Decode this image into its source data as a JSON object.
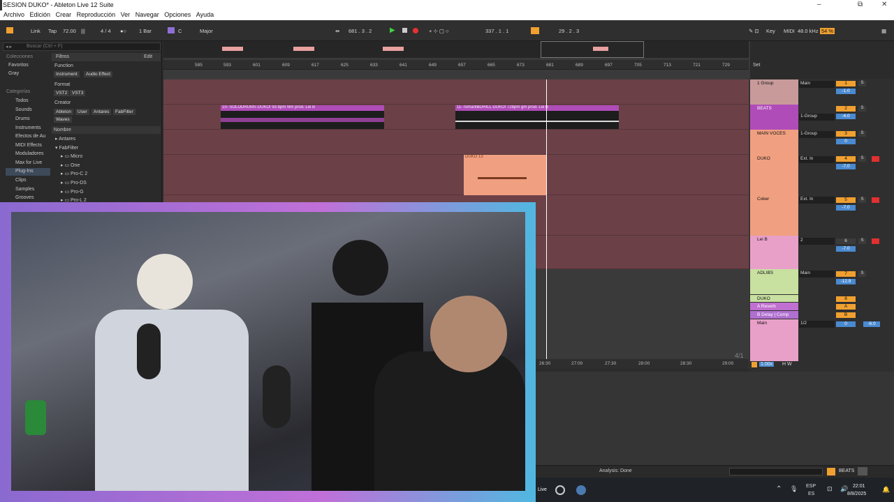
{
  "window": {
    "title": "SESION DUKO* - Ableton Live 12 Suite",
    "controls": [
      "–",
      "⧉",
      "✕"
    ]
  },
  "menu": [
    "Archivo",
    "Edición",
    "Crear",
    "Reproducción",
    "Ver",
    "Navegar",
    "Opciones",
    "Ayuda"
  ],
  "transport": {
    "link": "Link",
    "tap": "Tap",
    "tempo": "72.00",
    "sig": "4 / 4",
    "quant": "1 Bar",
    "key": "C",
    "scale": "Major",
    "pos": "681 .  3 .  2",
    "loop": "337 .  1 .  1",
    "len": "29 .  2 .  3",
    "key_btn": "Key",
    "midi": "MIDI",
    "sr": "48.0 kHz",
    "cpu": "54 %"
  },
  "browser": {
    "search": "Buscar (Ctrl + F)",
    "filtros": "Filtros",
    "edit": "Edit",
    "col_header": "Colecciones",
    "collections": [
      "Favoritos",
      "Gray"
    ],
    "cat_header": "Categorías",
    "categories": [
      "Todos",
      "Sounds",
      "Drums",
      "Instruments",
      "Efectos de Au",
      "MIDI Effects",
      "Moduladores",
      "Max for Live",
      "Plug-Ins",
      "Clips",
      "Samples",
      "Grooves"
    ],
    "function": "Function",
    "function_tags": [
      "Instrument",
      "Audio Effect"
    ],
    "format": "Format",
    "format_tags": [
      "VST2",
      "VST3"
    ],
    "creator": "Creator",
    "creator_tags": [
      "Ableton",
      "User",
      "Antares",
      "FabFilter",
      "Waves"
    ],
    "nombre": "Nombre",
    "tree": [
      "Antares",
      "FabFilter",
      "Micro",
      "One",
      "Pro-C 2",
      "Pro-DS",
      "Pro-G",
      "Pro-L 2"
    ]
  },
  "ruler": [
    "585",
    "593",
    "601",
    "609",
    "617",
    "625",
    "633",
    "641",
    "649",
    "657",
    "665",
    "673",
    "681",
    "689",
    "697",
    "705",
    "713",
    "721",
    "729"
  ],
  "clips": {
    "solodrums": "10- SOLODRUMS DUKO! 93 bpm film prod. Lei B",
    "romantic": "11- romantikDRILL DUKO! 72bpm gm prod. Lei B",
    "duko": "DUKO 13",
    "coker": "Coker 13"
  },
  "tracks": [
    {
      "name": "1 Group",
      "io": "Main",
      "num": "1",
      "vol": "-1.0"
    },
    {
      "name": "BEATS",
      "io": "1-Group",
      "num": "2",
      "vol": "-4.0"
    },
    {
      "name": "MAIN VOCES",
      "io": "1-Group",
      "num": "3",
      "vol": "0"
    },
    {
      "name": "DUKO",
      "io": "Ext. In",
      "num": "4",
      "vol": "-7.0"
    },
    {
      "name": "Coker",
      "io": "Ext. In",
      "num": "5",
      "vol": "-7.0"
    },
    {
      "name": "Lei B",
      "io": "2",
      "num": "6",
      "vol": "-7.0"
    },
    {
      "name": "ADLIBS",
      "io": "Main",
      "num": "7",
      "vol": "-12.9"
    },
    {
      "name": "DUKO",
      "io": "",
      "num": "8",
      "vol": ""
    },
    {
      "name": "A Reverb",
      "io": "",
      "num": "A",
      "vol": ""
    },
    {
      "name": "B Delay | Comp",
      "io": "",
      "num": "B",
      "vol": ""
    },
    {
      "name": "Main",
      "io": "1/2",
      "num": "0",
      "vol": "-6.0"
    }
  ],
  "set": "Set",
  "time_ruler": [
    "26:30",
    "27:00",
    "27:30",
    "28:00",
    "28:30",
    "29:00"
  ],
  "zoom": "1.00x",
  "page_ind": "4/1",
  "status": {
    "analysis": "Analysis: Done",
    "track": "BEATS"
  },
  "taskbar": {
    "lang": "ESP",
    "lang2": "ES",
    "time": "22:01",
    "date": "8/8/2025",
    "live": "Live"
  }
}
